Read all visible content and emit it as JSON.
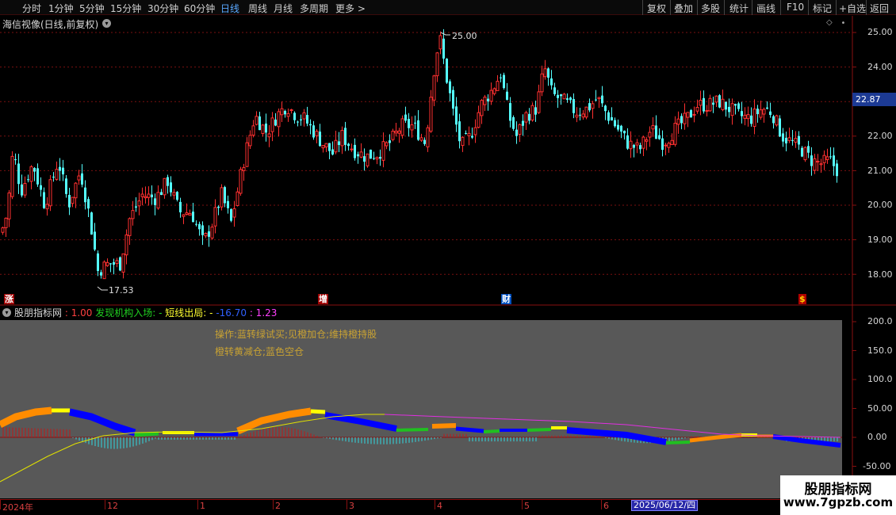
{
  "toolbar": {
    "periods": [
      "分时",
      "1分钟",
      "5分钟",
      "15分钟",
      "30分钟",
      "60分钟",
      "日线",
      "周线",
      "月线",
      "多周期",
      "更多 >"
    ],
    "active_period": "日线",
    "buttons": [
      "复权",
      "叠加",
      "多股",
      "统计",
      "画线",
      "F10",
      "标记",
      "+自选",
      "返回"
    ]
  },
  "main_panel": {
    "title": "海信视像(日线,前复权)",
    "price_axis": [
      "25.00",
      "24.00",
      "23.00",
      "22.00",
      "21.00",
      "20.00",
      "19.00",
      "18.00"
    ],
    "current_price_tag": "22.87",
    "high_label": "25.00",
    "low_label": "17.53",
    "event_tags": [
      "涨",
      "增",
      "财",
      "$"
    ]
  },
  "indicator_panel": {
    "name": "股朋指标网",
    "value1": ": 1.00",
    "label2": "发现机构入场: -",
    "label3": "短线出局: -",
    "value4": "-16.70",
    "value5": ": 1.23",
    "note1": "操作:蓝转绿试买;见橙加仓;维持橙持股",
    "note2": "橙转黄减仓;蓝色空仓",
    "axis": [
      "200.0",
      "150.0",
      "100.0",
      "50.00",
      "0.00",
      "-50.00"
    ]
  },
  "date_axis": {
    "ticks": [
      "2024年",
      "12",
      "1",
      "2",
      "3",
      "4",
      "5",
      "6"
    ],
    "cursor_date": "2025/06/12/四"
  },
  "watermark": {
    "line1": "股朋指标网",
    "line2": "www.7gpzb.com"
  },
  "colors": {
    "up_candle": "#ff3030",
    "down_candle": "#54ffff",
    "indicator_bg": "#585858",
    "price_tag_bg": "#1c3a94",
    "orange_band": "#ff8c00",
    "blue_band": "#0000ff",
    "green_band": "#20c020",
    "yellow_band": "#ffff00",
    "yellow_line": "#e0e000",
    "magenta_line": "#e030e0"
  }
}
